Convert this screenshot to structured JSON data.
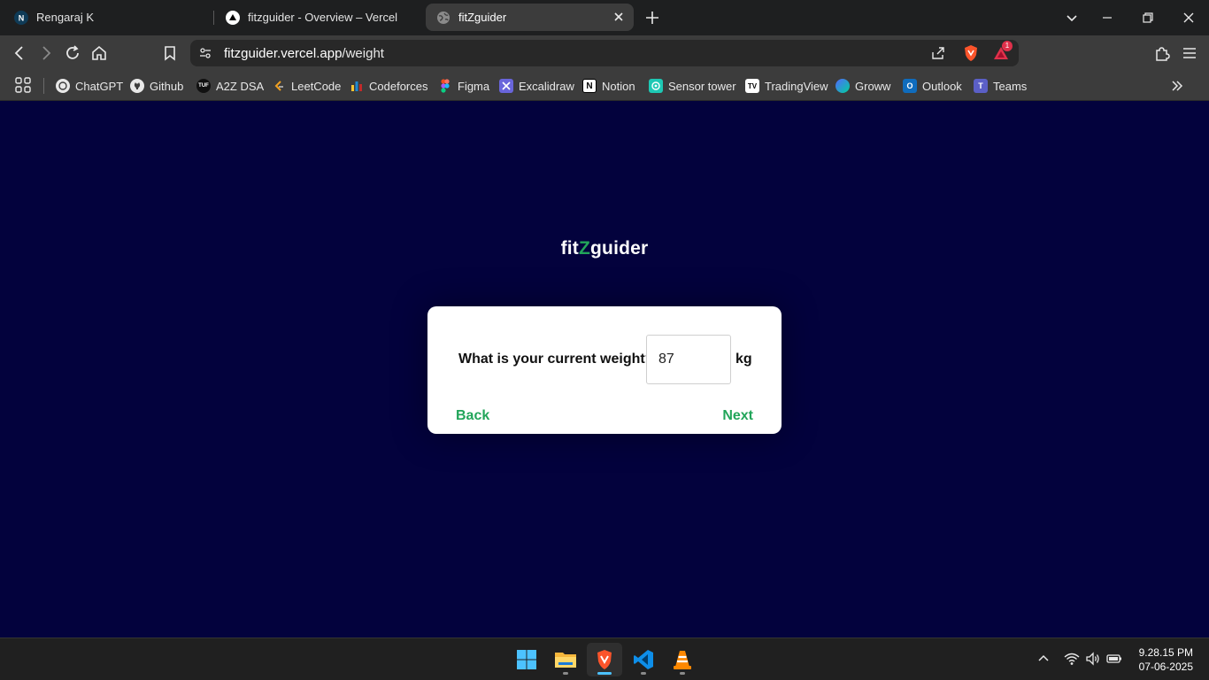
{
  "browser": {
    "tabs": [
      {
        "title": "Rengaraj K",
        "favicon": "notion-n-icon",
        "active": false
      },
      {
        "title": "fitzguider - Overview – Vercel",
        "favicon": "vercel-triangle-icon",
        "active": false
      },
      {
        "title": "fitZguider",
        "favicon": "globe-icon",
        "active": true
      }
    ],
    "url_host": "fitzguider.vercel.app",
    "url_path": "/weight",
    "brave_rewards_count": "1",
    "bookmarks": [
      {
        "label": "ChatGPT",
        "icon": "chatgpt-icon"
      },
      {
        "label": "Github",
        "icon": "github-icon"
      },
      {
        "label": "A2Z DSA",
        "icon": "tuf-icon"
      },
      {
        "label": "LeetCode",
        "icon": "leetcode-icon"
      },
      {
        "label": "Codeforces",
        "icon": "codeforces-icon"
      },
      {
        "label": "Figma",
        "icon": "figma-icon"
      },
      {
        "label": "Excalidraw",
        "icon": "excalidraw-icon"
      },
      {
        "label": "Notion",
        "icon": "notion-icon"
      },
      {
        "label": "Sensor tower",
        "icon": "sensor-tower-icon"
      },
      {
        "label": "TradingView",
        "icon": "tradingview-icon"
      },
      {
        "label": "Groww",
        "icon": "groww-icon"
      },
      {
        "label": "Outlook",
        "icon": "outlook-icon"
      },
      {
        "label": "Teams",
        "icon": "teams-icon"
      }
    ]
  },
  "page": {
    "brand_prefix": "fit",
    "brand_z": "Z",
    "brand_suffix": "guider",
    "question": "What is your current weight?",
    "weight_value": "87",
    "unit": "kg",
    "back_label": "Back",
    "next_label": "Next",
    "colors": {
      "background": "#03023d",
      "accent": "#22a55a",
      "card": "#ffffff"
    }
  },
  "taskbar": {
    "apps": [
      "windows-start-icon",
      "file-explorer-icon",
      "brave-browser-icon",
      "vscode-icon",
      "vlc-icon"
    ],
    "time": "9.28.15 PM",
    "date": "07-06-2025"
  }
}
